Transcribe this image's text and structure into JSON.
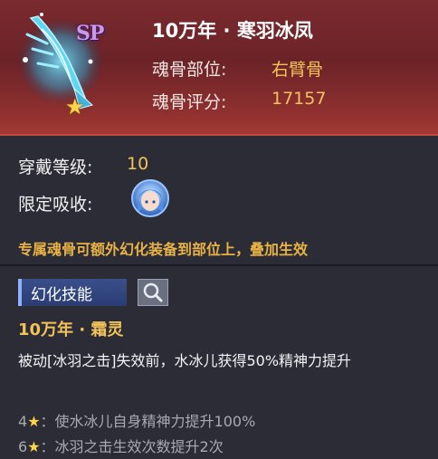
{
  "header": {
    "title": "10万年 · 寒羽冰凤",
    "badge": "SP",
    "star_icon": "star-icon",
    "rows": [
      {
        "label": "魂骨部位:",
        "value": "右臂骨"
      },
      {
        "label": "魂骨评分:",
        "value": "17157"
      }
    ]
  },
  "info": {
    "wear_label": "穿戴等级:",
    "wear_value": "10",
    "limit_label": "限定吸收:",
    "note": "专属魂骨可额外幻化装备到部位上，叠加生效"
  },
  "skill": {
    "tab_label": "幻化技能",
    "name": "10万年 · 霜灵",
    "desc": "被动[冰羽之击]失效前，水冰儿获得50%精神力提升",
    "stars": [
      {
        "level": "4",
        "text": "：使水冰儿自身精神力提升100%"
      },
      {
        "level": "6",
        "text": "：冰羽之击生效次数提升2次"
      }
    ]
  },
  "colors": {
    "accent_gold": "#f3c35a",
    "header_red": "#7a2a2f",
    "body_bg": "#2b2c36"
  }
}
